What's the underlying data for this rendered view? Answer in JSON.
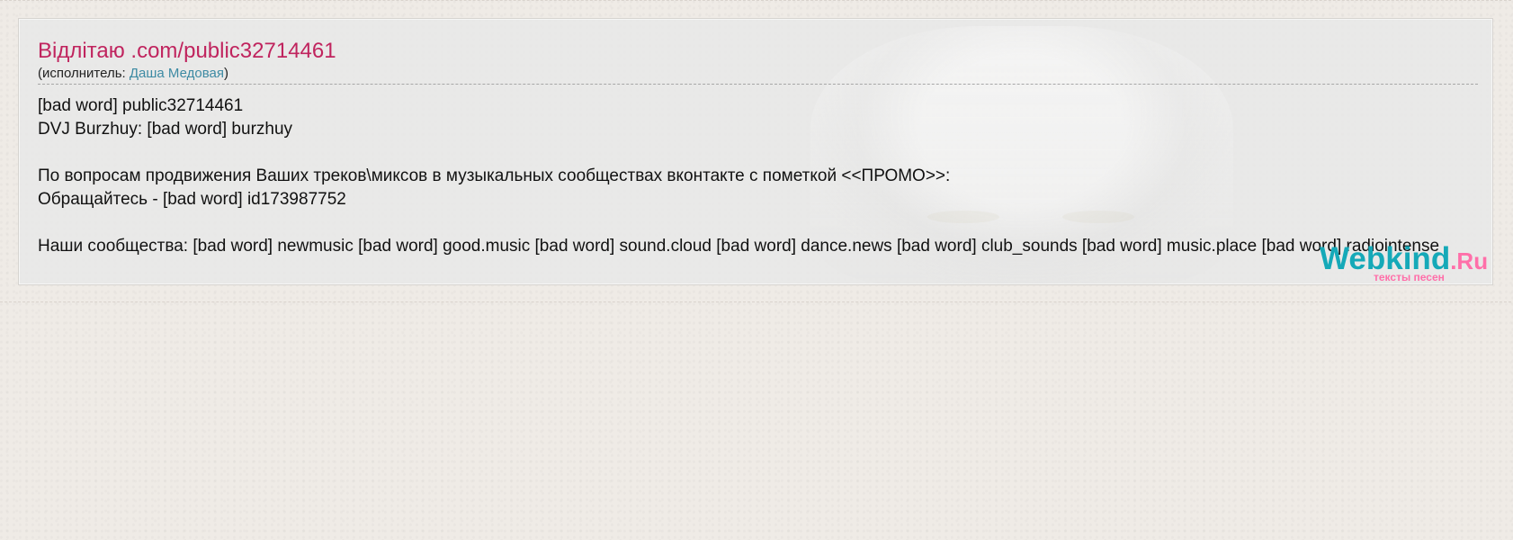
{
  "page": {
    "title": "Відлітаю .com/public32714461",
    "performer_prefix": "(исполнитель: ",
    "performer_name": "Даша Медовая",
    "performer_suffix": ")"
  },
  "lyrics": {
    "lines": [
      "[bad word] public32714461",
      "DVJ Burzhuy: [bad word] burzhuy",
      "",
      "По вопросам продвижения Ваших треков\\миксов в музыкальных сообществах вконтакте с пометкой <<ПРОМО>>:",
      "Обращайтесь - [bad word] id173987752",
      "",
      "Наши сообщества: [bad word] newmusic [bad word] good.music [bad word] sound.cloud [bad word] dance.news [bad word] club_sounds [bad word] music.place [bad word] radiointense"
    ]
  },
  "watermark": {
    "brand": "Webkind",
    "tld": ".Ru",
    "subtitle": "тексты песен"
  },
  "colors": {
    "title": "#c0245e",
    "link": "#3d8aa3",
    "watermark_primary": "#15a9b8",
    "watermark_accent": "#ff6fa9"
  }
}
